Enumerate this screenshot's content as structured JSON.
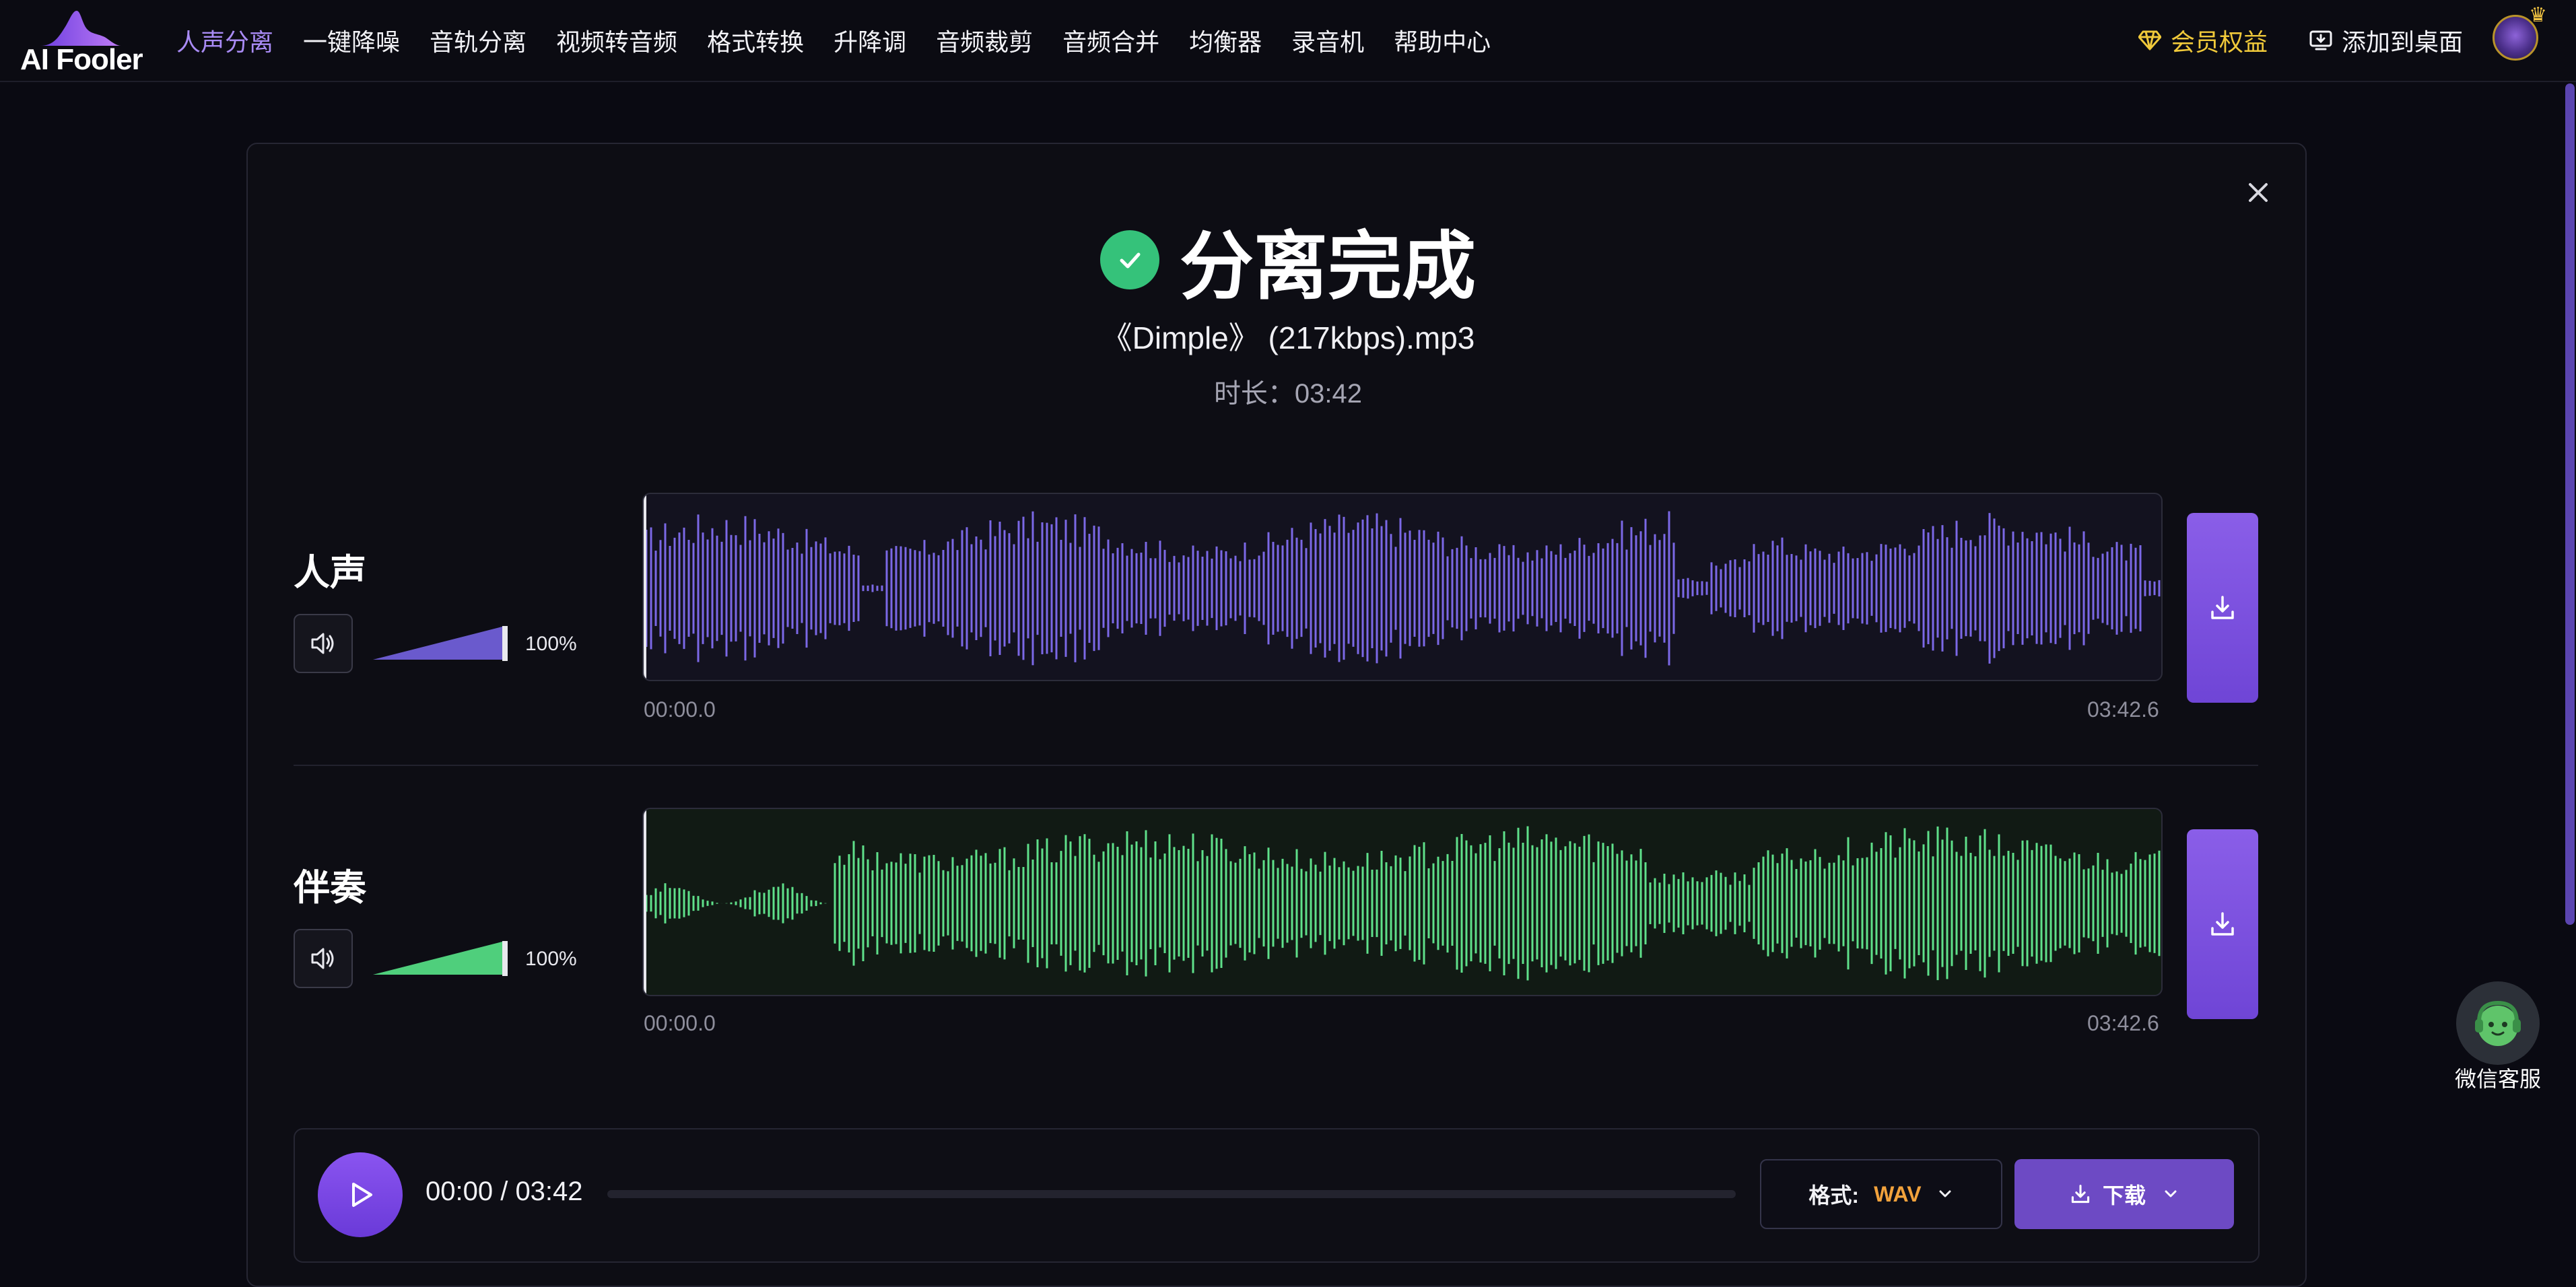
{
  "app": {
    "logo_text": "AI Fooler"
  },
  "nav": {
    "items": [
      {
        "label": "人声分离",
        "active": true
      },
      {
        "label": "一键降噪"
      },
      {
        "label": "音轨分离"
      },
      {
        "label": "视频转音频"
      },
      {
        "label": "格式转换"
      },
      {
        "label": "升降调"
      },
      {
        "label": "音频裁剪"
      },
      {
        "label": "音频合并"
      },
      {
        "label": "均衡器"
      },
      {
        "label": "录音机"
      },
      {
        "label": "帮助中心"
      }
    ],
    "vip_label": "会员权益",
    "add_desktop_label": "添加到桌面"
  },
  "result": {
    "title": "分离完成",
    "filename": "《Dimple》 (217kbps).mp3",
    "duration_text": "时长：03:42"
  },
  "tracks": [
    {
      "name": "人声",
      "volume_text": "100%",
      "volume": 1.0,
      "time_start": "00:00.0",
      "time_end": "03:42.6",
      "color": "#7b68e6",
      "fill_color": "#6a5acd"
    },
    {
      "name": "伴奏",
      "volume_text": "100%",
      "volume": 1.0,
      "time_start": "00:00.0",
      "time_end": "03:42.6",
      "color": "#5fe08a",
      "fill_color": "#4fcf7c"
    }
  ],
  "player": {
    "time_text": "00:00 / 03:42",
    "progress": 0,
    "format_label": "格式:",
    "format_value": "WAV",
    "download_label": "下载"
  },
  "support": {
    "label": "微信客服"
  },
  "colors": {
    "accent": "#7c4fe0",
    "vip_gold": "#f0c93a",
    "success": "#35c27a"
  },
  "icons": {
    "close": "close-icon",
    "check": "check-icon",
    "volume": "speaker-icon",
    "download": "download-icon",
    "play": "play-icon",
    "chevron": "chevron-down-icon",
    "vip": "diamond-icon",
    "desktop": "monitor-download-icon",
    "wechat": "support-agent-icon"
  }
}
